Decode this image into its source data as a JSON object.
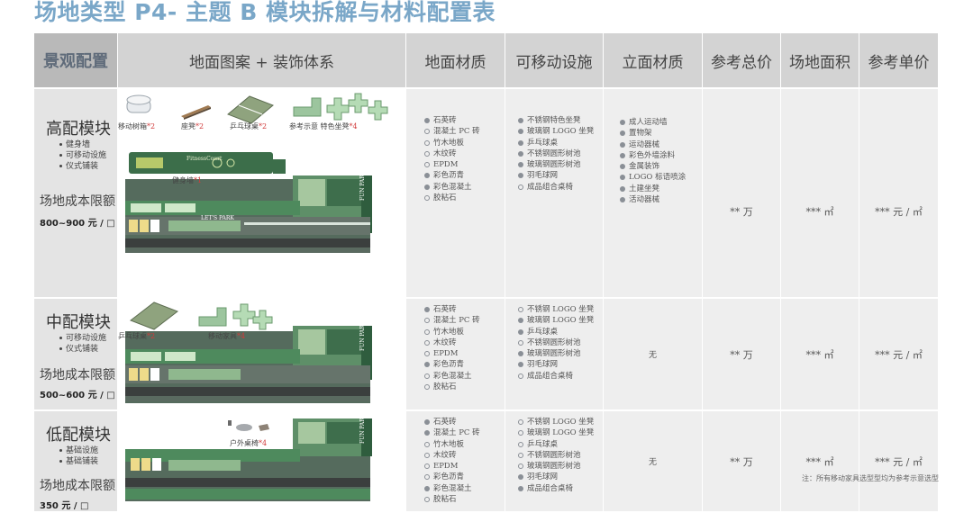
{
  "title": "场地类型 P4- 主题 B 模块拆解与材料配置表",
  "headers": [
    "景观配置",
    "地面图案 + 装饰体系",
    "地面材质",
    "可移动设施",
    "立面材质",
    "参考总价",
    "场地面积",
    "参考单价"
  ],
  "rows": [
    {
      "tier": "高配模块",
      "subs": [
        "健身墙",
        "可移动设施",
        "仪式铺装"
      ],
      "cost_label": "场地成本限额",
      "cost_value": "800~900 元 / □",
      "images": [
        {
          "label": "移动树箱",
          "count": "*2"
        },
        {
          "label": "座凳",
          "count": "*2"
        },
        {
          "label": "乒乓球桌",
          "count": "*2"
        },
        {
          "label": "参考示意  特色坐凳",
          "count": "*4"
        },
        {
          "label": "健身墙",
          "count": "*1"
        }
      ],
      "ground": [
        {
          "f": true,
          "t": "石英砖"
        },
        {
          "f": false,
          "t": "混凝土 PC 砖"
        },
        {
          "f": false,
          "t": "竹木地板"
        },
        {
          "f": false,
          "t": "木纹砖"
        },
        {
          "f": false,
          "t": "EPDM"
        },
        {
          "f": true,
          "t": "彩色沥青"
        },
        {
          "f": true,
          "t": "彩色混凝土"
        },
        {
          "f": false,
          "t": "胶粘石"
        }
      ],
      "movable": [
        {
          "f": true,
          "t": "不锈钢特色坐凳"
        },
        {
          "f": true,
          "t": "玻璃钢 LOGO 坐凳"
        },
        {
          "f": true,
          "t": "乒乓球桌"
        },
        {
          "f": true,
          "t": "不锈钢圆形树池"
        },
        {
          "f": true,
          "t": "玻璃钢圆形树池"
        },
        {
          "f": true,
          "t": "羽毛球网"
        },
        {
          "f": false,
          "t": "成品组合桌椅"
        }
      ],
      "facade": [
        {
          "f": true,
          "t": "成人运动墙"
        },
        {
          "f": true,
          "t": "置物架"
        },
        {
          "f": true,
          "t": "运动器械"
        },
        {
          "f": true,
          "t": "彩色外墙涂料"
        },
        {
          "f": true,
          "t": "金属装饰"
        },
        {
          "f": true,
          "t": "LOGO 标语喷涂"
        },
        {
          "f": true,
          "t": "土建坐凳"
        },
        {
          "f": true,
          "t": "活动器械"
        }
      ],
      "total": "** 万",
      "area": "*** ㎡",
      "unit": "*** 元 / ㎡"
    },
    {
      "tier": "中配模块",
      "subs": [
        "可移动设施",
        "仪式铺装"
      ],
      "cost_label": "场地成本限额",
      "cost_value": "500~600 元 / □",
      "images": [
        {
          "label": "乒乓球桌",
          "count": "*2"
        },
        {
          "label": "移动家具",
          "count": "*4"
        }
      ],
      "ground": [
        {
          "f": true,
          "t": "石英砖"
        },
        {
          "f": false,
          "t": "混凝土 PC 砖"
        },
        {
          "f": false,
          "t": "竹木地板"
        },
        {
          "f": false,
          "t": "木纹砖"
        },
        {
          "f": false,
          "t": "EPDM"
        },
        {
          "f": true,
          "t": "彩色沥青"
        },
        {
          "f": false,
          "t": "彩色混凝土"
        },
        {
          "f": false,
          "t": "胶粘石"
        }
      ],
      "movable": [
        {
          "f": false,
          "t": "不锈钢 LOGO 坐凳"
        },
        {
          "f": true,
          "t": "玻璃钢 LOGO 坐凳"
        },
        {
          "f": true,
          "t": "乒乓球桌"
        },
        {
          "f": false,
          "t": "不锈钢圆形树池"
        },
        {
          "f": true,
          "t": "玻璃钢圆形树池"
        },
        {
          "f": true,
          "t": "羽毛球网"
        },
        {
          "f": false,
          "t": "成品组合桌椅"
        }
      ],
      "facade_text": "无",
      "total": "** 万",
      "area": "*** ㎡",
      "unit": "*** 元 / ㎡"
    },
    {
      "tier": "低配模块",
      "subs": [
        "基础设施",
        "基础铺装"
      ],
      "cost_label": "场地成本限额",
      "cost_value": "350 元 / □",
      "images": [
        {
          "label": "户外桌椅",
          "count": "*4"
        }
      ],
      "ground": [
        {
          "f": true,
          "t": "石英砖"
        },
        {
          "f": true,
          "t": "混凝土 PC 砖"
        },
        {
          "f": false,
          "t": "竹木地板"
        },
        {
          "f": false,
          "t": "木纹砖"
        },
        {
          "f": false,
          "t": "EPDM"
        },
        {
          "f": false,
          "t": "彩色沥青"
        },
        {
          "f": true,
          "t": "彩色混凝土"
        },
        {
          "f": false,
          "t": "胶粘石"
        }
      ],
      "movable": [
        {
          "f": false,
          "t": "不锈钢 LOGO 坐凳"
        },
        {
          "f": false,
          "t": "玻璃钢 LOGO 坐凳"
        },
        {
          "f": false,
          "t": "乒乓球桌"
        },
        {
          "f": false,
          "t": "不锈钢圆形树池"
        },
        {
          "f": false,
          "t": "玻璃钢圆形树池"
        },
        {
          "f": true,
          "t": "羽毛球网"
        },
        {
          "f": true,
          "t": "成品组合桌椅"
        }
      ],
      "facade_text": "无",
      "total": "** 万",
      "area": "*** ㎡",
      "unit": "*** 元 / ㎡"
    }
  ],
  "plan_text": {
    "fun_park": "FUN PARK",
    "fitness_court": "FitnessCourt",
    "sign": "LET'S PARK"
  },
  "note": "注：所有移动家具选型型均为参考示意选型"
}
